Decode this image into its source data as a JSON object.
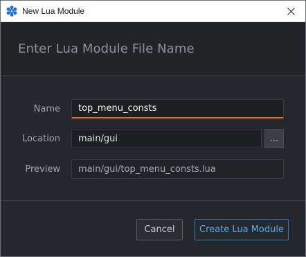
{
  "window": {
    "title": "New Lua Module"
  },
  "header": {
    "title": "Enter Lua Module File Name"
  },
  "form": {
    "name_label": "Name",
    "name_value": "top_menu_consts",
    "location_label": "Location",
    "location_value": "main/gui",
    "browse_label": "...",
    "preview_label": "Preview",
    "preview_value": "main/gui/top_menu_consts.lua"
  },
  "footer": {
    "cancel_label": "Cancel",
    "create_label": "Create Lua Module"
  },
  "colors": {
    "accent_focus": "#e8701e",
    "primary_button": "#56a8ee",
    "app_icon": "#1e6fd9"
  },
  "icons": {
    "app": "defold-logo-icon",
    "close": "close-icon"
  }
}
